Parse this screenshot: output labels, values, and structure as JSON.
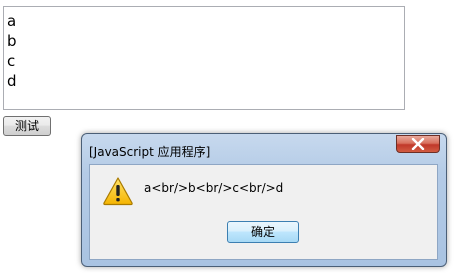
{
  "textarea": {
    "value": "a\nb\nc\nd"
  },
  "test_button": {
    "label": "测试"
  },
  "dialog": {
    "title": "[JavaScript 应用程序]",
    "message": "a<br/>b<br/>c<br/>d",
    "ok_label": "确定",
    "icon": "warning-icon",
    "close_icon": "close-icon"
  }
}
